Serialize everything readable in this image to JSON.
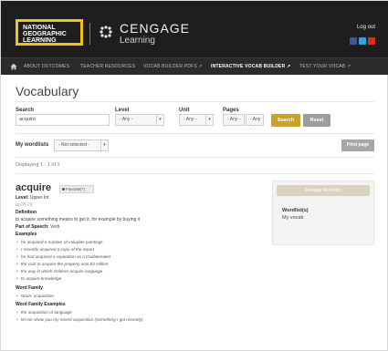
{
  "brand": {
    "natgeo_lines": [
      "NATIONAL",
      "GEOGRAPHIC",
      "LEARNING"
    ],
    "cengage_line1": "CENGAGE",
    "cengage_line2": "Learning"
  },
  "header": {
    "logout_label": "Log out",
    "social_icons": [
      "facebook-icon",
      "twitter-icon",
      "youtube-icon"
    ],
    "social_colors": [
      "#3b5998",
      "#2aa9e0",
      "#d9301e"
    ]
  },
  "nav": {
    "items": [
      {
        "label": "ABOUT OUTCOMES"
      },
      {
        "label": "TEACHER RESOURCES"
      },
      {
        "label": "VOCAB BUILDER PDFS ↗"
      },
      {
        "label": "INTERACTIVE VOCAB BUILDER ↗"
      },
      {
        "label": "TEST YOUR VOCAB ↗"
      }
    ]
  },
  "page": {
    "title": "Vocabulary"
  },
  "filters": {
    "search_label": "Search",
    "search_value": "acquire",
    "level_label": "Level",
    "level_value": "- Any -",
    "unit_label": "Unit",
    "unit_value": "- Any -",
    "pages_label": "Pages",
    "pages_from": "- Any -",
    "pages_to": "- Any -",
    "search_button": "Search",
    "reset_button": "Reset"
  },
  "wordlists": {
    "label": "My wordlists",
    "value": "- Not selected -",
    "print_button": "Print page"
  },
  "results": {
    "displaying": "Displaying 1 - 1 of 1"
  },
  "entry": {
    "word": "acquire",
    "badge": "Favorite(*)",
    "level_label": "Level:",
    "level_value": "Upper Int",
    "pages_ref": "pp28-29",
    "definition_label": "Definition",
    "definition": "to acquire something means to get it, for example by buying it",
    "pos_label": "Part of Speech:",
    "pos_value": "Verb",
    "examples_label": "Examples",
    "examples": [
      "he acquired a number of valuable paintings",
      "I recently acquired a copy of the report",
      "he had acquired a reputation as a troublemaker",
      "the cost to acquire the property was $3 million",
      "the way in which children acquire language",
      "to acquire knowledge"
    ],
    "family_label": "Word Family",
    "family": [
      "Noun: acquisition"
    ],
    "family_examples_label": "Word Family Examples",
    "family_examples": [
      "the acquisition of language",
      "let me show you my recent acquisition (something I got recently)"
    ]
  },
  "side_panel": {
    "manage_button": "Manage Wordlists",
    "wordlists_title": "Wordlist(s)",
    "wordlists_item": "My vocab"
  },
  "colors": {
    "natgeo_yellow": "#f3c31a",
    "search_button": "#c9a227",
    "header_bg": "#1e1e1e"
  }
}
